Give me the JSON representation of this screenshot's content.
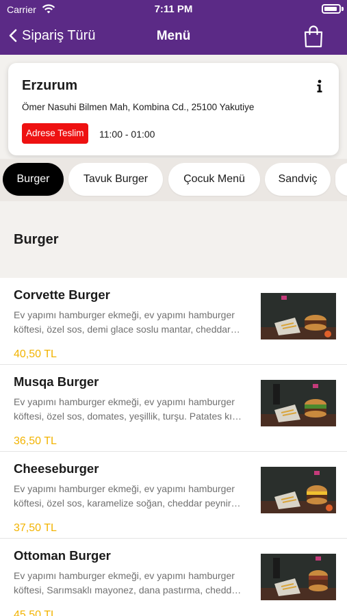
{
  "status_bar": {
    "carrier": "Carrier",
    "time": "7:11 PM"
  },
  "nav": {
    "back_label": "Sipariş Türü",
    "title": "Menü"
  },
  "store": {
    "name": "Erzurum",
    "address": "Ömer Nasuhi Bilmen Mah, Kombina Cd., 25100 Yakutiye",
    "delivery_label": "Adrese Teslim",
    "hours": "11:00 - 01:00"
  },
  "tabs": [
    {
      "label": "Burger",
      "active": true
    },
    {
      "label": "Tavuk Burger",
      "active": false
    },
    {
      "label": "Çocuk Menü",
      "active": false
    },
    {
      "label": "Sandviç",
      "active": false
    }
  ],
  "section": {
    "title": "Burger"
  },
  "items": [
    {
      "name": "Corvette Burger",
      "desc": "Ev yapımı hamburger ekmeği, ev yapımı hamburger köftesi, özel sos, demi glace soslu mantar, cheddar…",
      "price": "40,50 TL"
    },
    {
      "name": "Musqa Burger",
      "desc": "Ev yapımı hamburger ekmeği, ev yapımı hamburger köftesi, özel sos, domates, yeşillik, turşu. Patates kı…",
      "price": "36,50 TL"
    },
    {
      "name": "Cheeseburger",
      "desc": "Ev yapımı hamburger ekmeği, ev yapımı hamburger köftesi, özel sos, karamelize soğan, cheddar peynir…",
      "price": "37,50 TL"
    },
    {
      "name": "Ottoman Burger",
      "desc": "Ev yapımı hamburger ekmeği, ev yapımı hamburger köftesi, Sarımsaklı mayonez, dana pastırma, chedd…",
      "price": "45,50 TL"
    }
  ],
  "colors": {
    "header": "#5b2a86",
    "price": "#f2b300",
    "badge": "#ee1111",
    "active_tab": "#000000"
  },
  "icons": [
    "wifi-icon",
    "battery-icon",
    "chevron-left-icon",
    "shopping-bag-icon",
    "info-icon"
  ]
}
